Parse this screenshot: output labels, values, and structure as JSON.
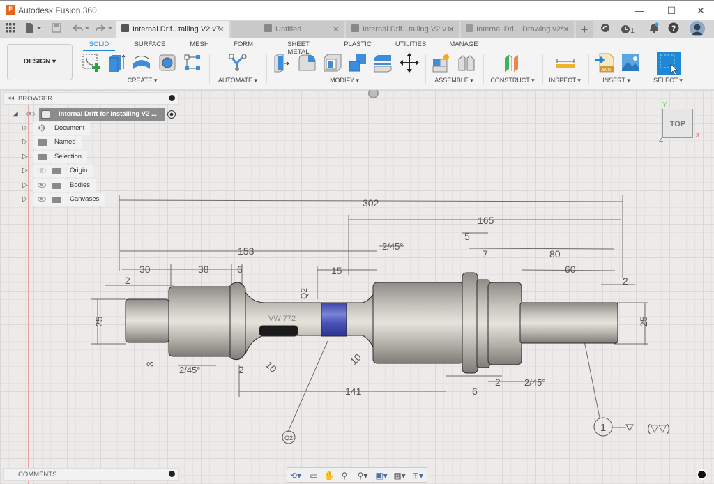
{
  "window": {
    "app_title": "Autodesk Fusion 360",
    "logo_letter": "F",
    "controls": {
      "minimize": "—",
      "maximize": "☐",
      "close": "✕"
    }
  },
  "tabbar": {
    "icons": [
      "apps-grid-icon",
      "file-icon",
      "save-icon",
      "undo-icon",
      "redo-icon"
    ],
    "tabs": [
      {
        "label": "Internal Drif...talling V2 v7",
        "active": true
      },
      {
        "label": "Untitled",
        "active": false
      },
      {
        "label": "Internal Drif...talling V2 v1",
        "active": false
      },
      {
        "label": "Internal Dri... Drawing v2*",
        "active": false
      }
    ],
    "new_tab": "+",
    "job_count": "1",
    "help": "?"
  },
  "toolbar": {
    "workspace": "DESIGN ▾",
    "tabs": [
      "SOLID",
      "SURFACE",
      "MESH",
      "FORM",
      "SHEET METAL",
      "PLASTIC",
      "UTILITIES",
      "MANAGE"
    ],
    "active_tab": "SOLID",
    "groups": [
      "CREATE ▾",
      "AUTOMATE ▾",
      "MODIFY ▾",
      "ASSEMBLE ▾",
      "CONSTRUCT ▾",
      "INSPECT ▾",
      "INSERT ▾",
      "SELECT ▾"
    ]
  },
  "browser": {
    "title": "BROWSER",
    "root": "Internal Drift for installing V2 ...",
    "items": [
      {
        "label": "Document Settings",
        "icon": "gear-icon"
      },
      {
        "label": "Named Views",
        "icon": "folder-icon"
      },
      {
        "label": "Selection Sets",
        "icon": "folder-icon"
      },
      {
        "label": "Origin",
        "icon": "folder-icon",
        "visible": false
      },
      {
        "label": "Bodies",
        "icon": "folder-icon",
        "visible": true
      },
      {
        "label": "Canvases",
        "icon": "folder-icon",
        "visible": true
      }
    ]
  },
  "viewcube": {
    "face": "TOP",
    "axes": {
      "x": "X",
      "y": "Y",
      "z": "Z"
    }
  },
  "drawing": {
    "dims": {
      "overall": "302",
      "d165": "165",
      "d153": "153",
      "d30": "30",
      "d38": "38",
      "d6a": "6",
      "d15": "15",
      "d2a": "2",
      "chamfer1": "2/45°",
      "d5": "5",
      "d7": "7",
      "d80": "80",
      "d60": "60",
      "d2b": "2",
      "d25l": "25",
      "d25r": "25",
      "d141": "141",
      "d6b": "6",
      "d2c": "2",
      "chamfer2": "2/45°",
      "chamfer3": "2/45°",
      "d2d": "2",
      "r10a": "10",
      "r10b": "10",
      "d3": "3",
      "q2": "Q2",
      "balloon1": "1",
      "balloon2": "Q2",
      "marking": "VW 772"
    }
  },
  "comments": {
    "title": "COMMENTS"
  }
}
